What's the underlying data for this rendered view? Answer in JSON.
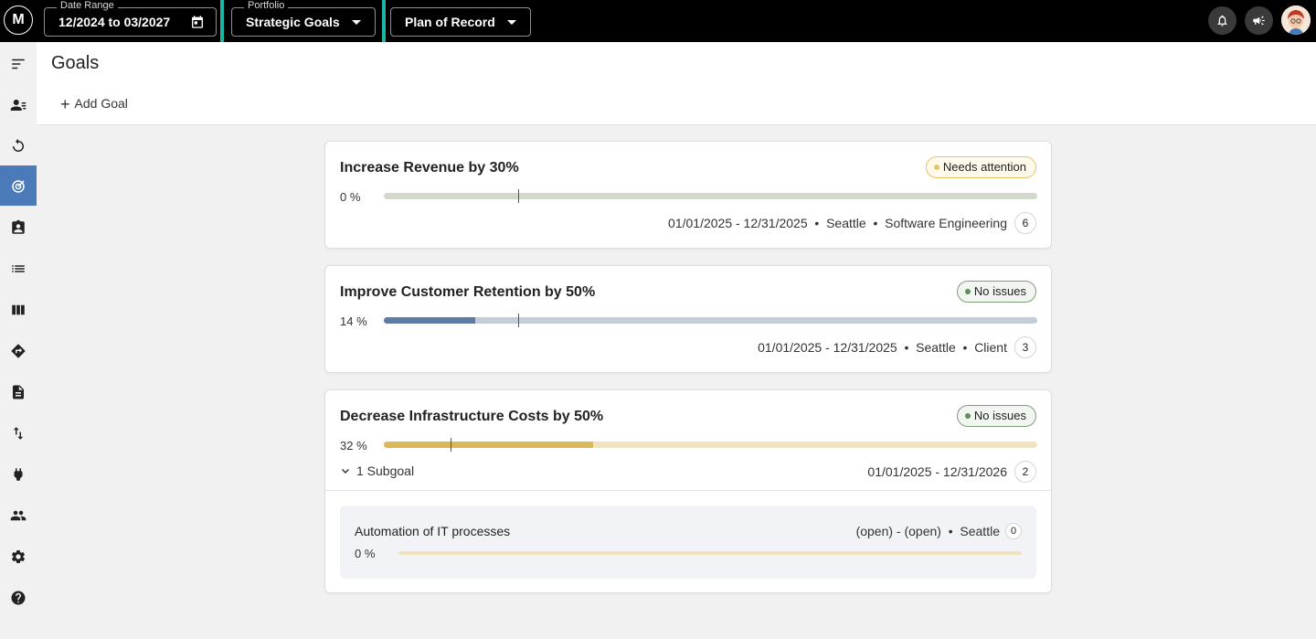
{
  "topbar": {
    "logo_text": "M",
    "date_range": {
      "legend": "Date Range",
      "value": "12/2024 to 03/2027"
    },
    "portfolio": {
      "legend": "Portfolio",
      "value": "Strategic Goals"
    },
    "plan": {
      "value": "Plan of Record"
    },
    "icons": [
      "bell-icon",
      "megaphone-icon"
    ],
    "highlight_color": "#1ab8a4"
  },
  "sidebar": {
    "items": [
      "menu",
      "people-list",
      "cycle",
      "goals",
      "contacts",
      "list",
      "board",
      "roadmap",
      "document",
      "transfer",
      "plug",
      "team",
      "settings",
      "help"
    ],
    "active": "goals",
    "active_color": "#4a7ab8"
  },
  "header": {
    "title": "Goals",
    "add_goal_label": "Add Goal"
  },
  "goals": [
    {
      "title": "Increase Revenue by 30%",
      "status": "Needs attention",
      "status_kind": "attention",
      "progress_label": "0 %",
      "progress": 0,
      "meta": "01/01/2025 - 12/31/2025  •  Seattle  •  Software Engineering",
      "count": "6",
      "fill_color": "#c7cfbf",
      "track_color": "#d2d9cb"
    },
    {
      "title": "Improve Customer Retention by 50%",
      "status": "No issues",
      "status_kind": "ok",
      "progress_label": "14 %",
      "progress": 14,
      "meta": "01/01/2025 - 12/31/2025  •  Seattle  •  Client",
      "count": "3",
      "fill_color": "#5b7ca8",
      "track_color": "#c3ccd9"
    },
    {
      "title": "Decrease Infrastructure Costs by 50%",
      "status": "No issues",
      "status_kind": "ok",
      "progress_label": "32 %",
      "progress": 32,
      "subgoal_label": "1 Subgoal",
      "meta": "01/01/2025 - 12/31/2026",
      "count": "2",
      "fill_color": "#dab85a",
      "track_color": "#f0e3bd",
      "subgoals": [
        {
          "title": "Automation of IT processes",
          "meta": "(open) - (open)  •  Seattle",
          "count": "0",
          "progress_label": "0 %",
          "progress": 0
        }
      ]
    }
  ]
}
